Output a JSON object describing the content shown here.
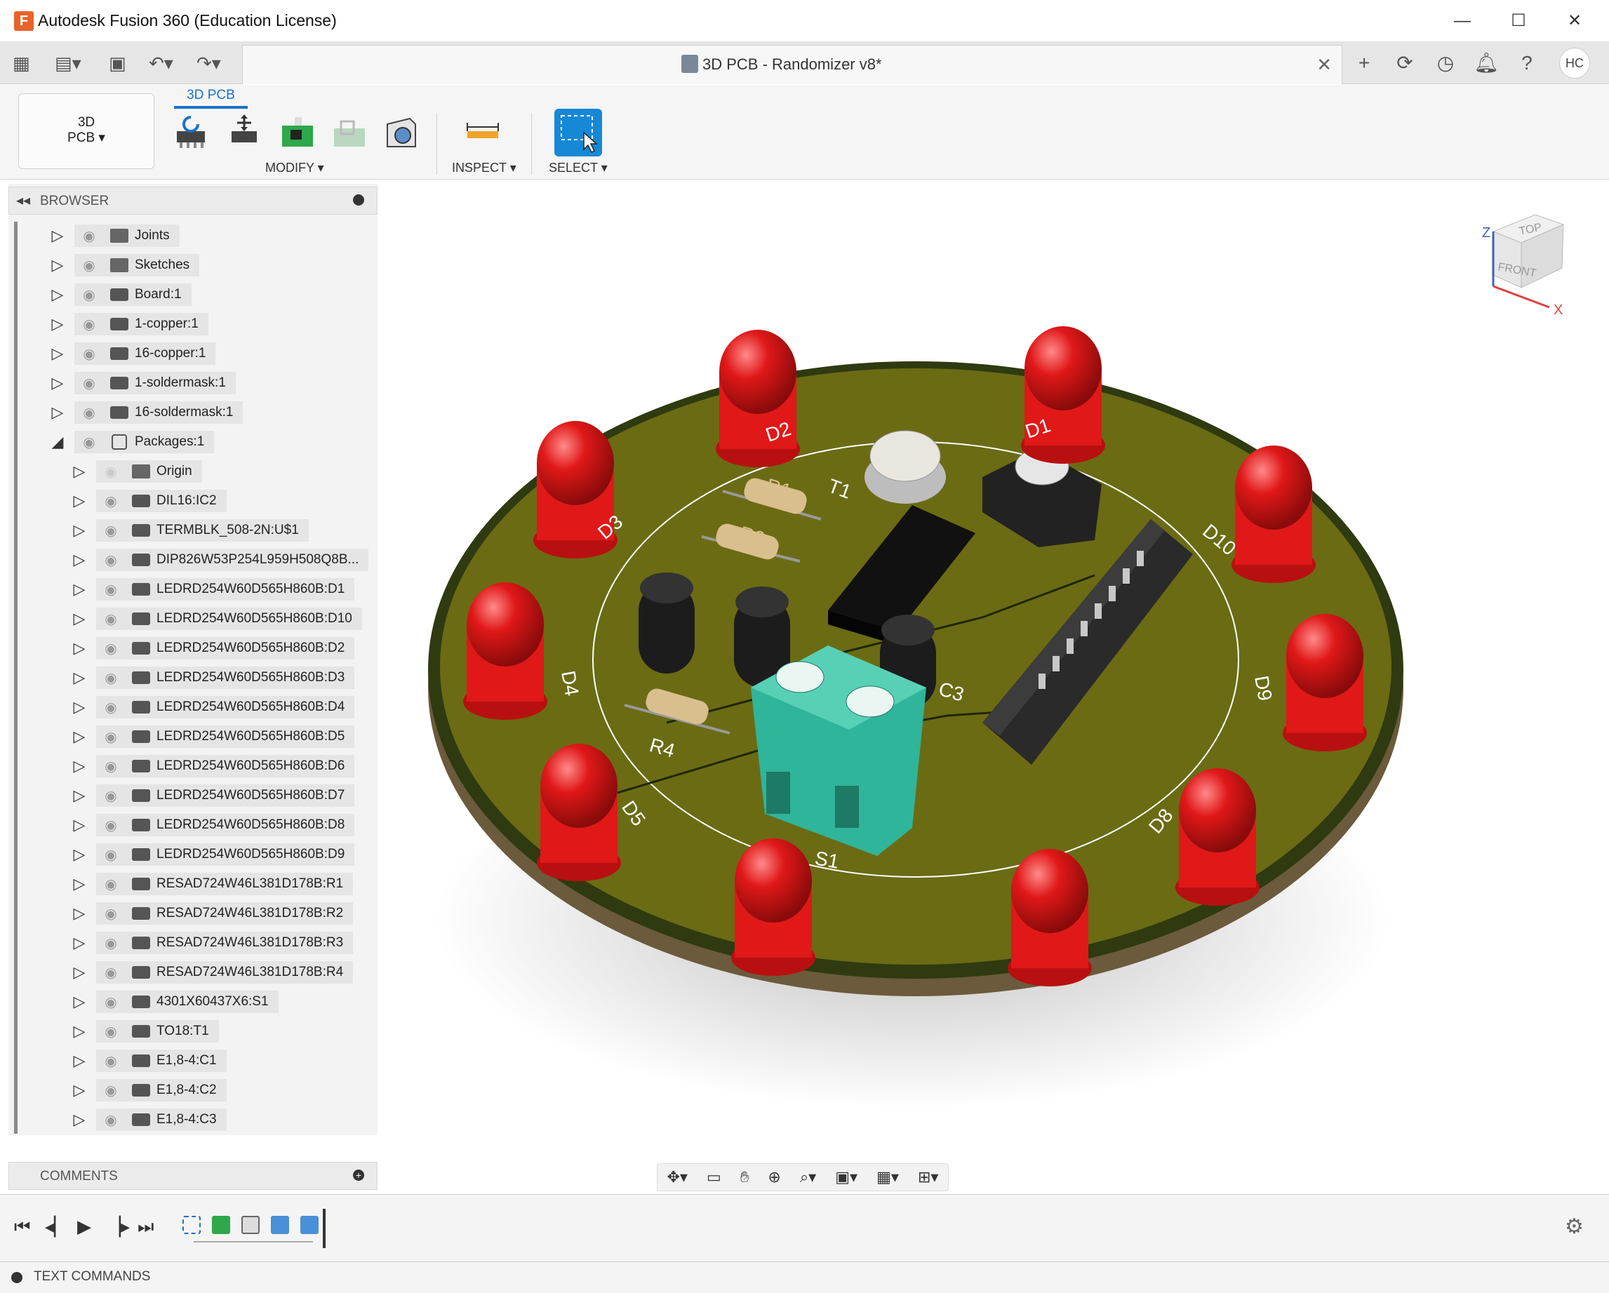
{
  "window": {
    "title": "Autodesk Fusion 360 (Education License)",
    "app_logo": "F",
    "minimize": "—",
    "maximize": "☐",
    "close": "✕"
  },
  "tabbar": {
    "document_title": "3D PCB - Randomizer v8*",
    "close_tab": "✕",
    "avatar_initials": "HC"
  },
  "ribbon": {
    "workspace_line1": "3D",
    "workspace_line2": "PCB ▾",
    "active_tab": "3D PCB",
    "groups": {
      "modify": "MODIFY ▾",
      "inspect": "INSPECT ▾",
      "select": "SELECT ▾"
    }
  },
  "browser": {
    "title": "BROWSER",
    "items": [
      {
        "label": "Joints",
        "icon": "folder-icon",
        "expanded": false,
        "level": 0
      },
      {
        "label": "Sketches",
        "icon": "folder-icon",
        "expanded": false,
        "level": 0
      },
      {
        "label": "Board:1",
        "icon": "component-icon",
        "expanded": false,
        "level": 0
      },
      {
        "label": "1-copper:1",
        "icon": "component-icon",
        "expanded": false,
        "level": 0
      },
      {
        "label": "16-copper:1",
        "icon": "component-icon",
        "expanded": false,
        "level": 0
      },
      {
        "label": "1-soldermask:1",
        "icon": "component-icon",
        "expanded": false,
        "level": 0
      },
      {
        "label": "16-soldermask:1",
        "icon": "component-icon",
        "expanded": false,
        "level": 0
      },
      {
        "label": "Packages:1",
        "icon": "package-icon",
        "expanded": true,
        "level": 0
      },
      {
        "label": "Origin",
        "icon": "folder-icon",
        "expanded": false,
        "level": 1
      },
      {
        "label": "DIL16:IC2",
        "icon": "component-icon",
        "expanded": false,
        "level": 1
      },
      {
        "label": "TERMBLK_508-2N:U$1",
        "icon": "component-icon",
        "expanded": false,
        "level": 1
      },
      {
        "label": "DIP826W53P254L959H508Q8B...",
        "icon": "component-icon",
        "expanded": false,
        "level": 1
      },
      {
        "label": "LEDRD254W60D565H860B:D1",
        "icon": "component-icon",
        "expanded": false,
        "level": 1
      },
      {
        "label": "LEDRD254W60D565H860B:D10",
        "icon": "component-icon",
        "expanded": false,
        "level": 1
      },
      {
        "label": "LEDRD254W60D565H860B:D2",
        "icon": "component-icon",
        "expanded": false,
        "level": 1
      },
      {
        "label": "LEDRD254W60D565H860B:D3",
        "icon": "component-icon",
        "expanded": false,
        "level": 1
      },
      {
        "label": "LEDRD254W60D565H860B:D4",
        "icon": "component-icon",
        "expanded": false,
        "level": 1
      },
      {
        "label": "LEDRD254W60D565H860B:D5",
        "icon": "component-icon",
        "expanded": false,
        "level": 1
      },
      {
        "label": "LEDRD254W60D565H860B:D6",
        "icon": "component-icon",
        "expanded": false,
        "level": 1
      },
      {
        "label": "LEDRD254W60D565H860B:D7",
        "icon": "component-icon",
        "expanded": false,
        "level": 1
      },
      {
        "label": "LEDRD254W60D565H860B:D8",
        "icon": "component-icon",
        "expanded": false,
        "level": 1
      },
      {
        "label": "LEDRD254W60D565H860B:D9",
        "icon": "component-icon",
        "expanded": false,
        "level": 1
      },
      {
        "label": "RESAD724W46L381D178B:R1",
        "icon": "component-icon",
        "expanded": false,
        "level": 1
      },
      {
        "label": "RESAD724W46L381D178B:R2",
        "icon": "component-icon",
        "expanded": false,
        "level": 1
      },
      {
        "label": "RESAD724W46L381D178B:R3",
        "icon": "component-icon",
        "expanded": false,
        "level": 1
      },
      {
        "label": "RESAD724W46L381D178B:R4",
        "icon": "component-icon",
        "expanded": false,
        "level": 1
      },
      {
        "label": "4301X60437X6:S1",
        "icon": "component-icon",
        "expanded": false,
        "level": 1
      },
      {
        "label": "TO18:T1",
        "icon": "component-icon",
        "expanded": false,
        "level": 1
      },
      {
        "label": "E1,8-4:C1",
        "icon": "component-icon",
        "expanded": false,
        "level": 1
      },
      {
        "label": "E1,8-4:C2",
        "icon": "component-icon",
        "expanded": false,
        "level": 1
      },
      {
        "label": "E1,8-4:C3",
        "icon": "component-icon",
        "expanded": false,
        "level": 1
      }
    ]
  },
  "comments": {
    "title": "COMMENTS"
  },
  "viewcube": {
    "top": "TOP",
    "front": "FRONT",
    "axis_x": "X",
    "axis_z": "Z"
  },
  "pcb_labels": {
    "d1": "D1",
    "d2": "D2",
    "d3": "D3",
    "d4": "D4",
    "d5": "D5",
    "d8": "D8",
    "d9": "D9",
    "d10": "D10",
    "t1": "T1",
    "r1": "R1",
    "r2": "R2",
    "r4": "R4",
    "c3": "C3",
    "s1": "S1"
  },
  "text_commands": {
    "label": "TEXT COMMANDS"
  },
  "colors": {
    "board": "#6b6b14",
    "board_edge": "#2f3a10",
    "led": "#e01818",
    "terminal": "#2fb59a",
    "accent": "#1a73c8",
    "select_tool": "#1588d6"
  }
}
